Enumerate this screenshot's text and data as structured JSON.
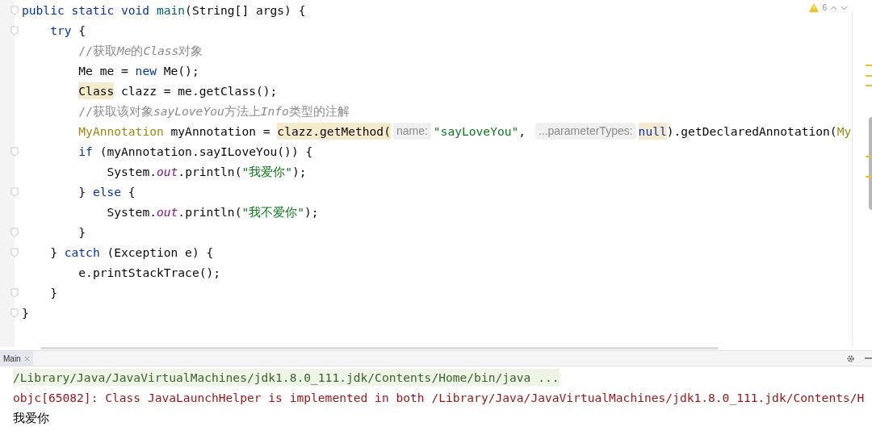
{
  "editor": {
    "inspection": {
      "count": "6"
    },
    "lines": [
      {
        "fold_marker": true,
        "tokens": [
          {
            "kind": "keyword",
            "text": "public static void "
          },
          {
            "kind": "method",
            "text": "main"
          },
          {
            "kind": "plain",
            "text": "(String[] args) {"
          }
        ],
        "children": [
          {
            "fold_marker": true,
            "tokens": [
              {
                "kind": "keyword",
                "text": "try"
              },
              {
                "kind": "plain",
                "text": " {"
              }
            ],
            "children": [
              {
                "fold_marker": false,
                "tokens": [
                  {
                    "kind": "comment",
                    "text": "//获取"
                  },
                  {
                    "kind": "comment_italic",
                    "text": "Me"
                  },
                  {
                    "kind": "comment",
                    "text": "的"
                  },
                  {
                    "kind": "comment_italic",
                    "text": "Class"
                  },
                  {
                    "kind": "comment",
                    "text": "对象"
                  }
                ]
              },
              {
                "fold_marker": false,
                "tokens": [
                  {
                    "kind": "plain",
                    "text": "Me me = "
                  },
                  {
                    "kind": "keyword",
                    "text": "new"
                  },
                  {
                    "kind": "plain",
                    "text": " Me();"
                  }
                ]
              },
              {
                "fold_marker": false,
                "tokens": [
                  {
                    "kind": "plain",
                    "text": "Class",
                    "highlighted": true
                  },
                  {
                    "kind": "plain",
                    "text": " clazz = me.getClass();"
                  }
                ]
              },
              {
                "fold_marker": false,
                "tokens": [
                  {
                    "kind": "comment",
                    "text": "//获取该对象"
                  },
                  {
                    "kind": "comment_italic",
                    "text": "sayLoveYou"
                  },
                  {
                    "kind": "comment",
                    "text": "方法上"
                  },
                  {
                    "kind": "comment_italic",
                    "text": "Info"
                  },
                  {
                    "kind": "comment",
                    "text": "类型的注解"
                  }
                ]
              },
              {
                "fold_marker": false,
                "tokens": [
                  {
                    "kind": "type",
                    "text": "MyAnnotation"
                  },
                  {
                    "kind": "plain",
                    "text": " myAnnotation = "
                  },
                  {
                    "kind": "plain",
                    "text": "clazz.getMethod(",
                    "highlighted": true
                  },
                  {
                    "kind": "hint",
                    "text": "name:"
                  },
                  {
                    "kind": "string",
                    "text": "\"sayLoveYou\""
                  },
                  {
                    "kind": "plain",
                    "text": ", "
                  },
                  {
                    "kind": "hint",
                    "text": "...parameterTypes:"
                  },
                  {
                    "kind": "keyword",
                    "text": "null",
                    "highlighted": true
                  },
                  {
                    "kind": "plain",
                    "text": ").getDeclaredAnnotation("
                  },
                  {
                    "kind": "type",
                    "text": "My"
                  }
                ]
              },
              {
                "fold_marker": true,
                "tokens": [
                  {
                    "kind": "keyword",
                    "text": "if"
                  },
                  {
                    "kind": "plain",
                    "text": " (myAnnotation.sayILoveYou()) {"
                  }
                ],
                "children": [
                  {
                    "fold_marker": false,
                    "tokens": [
                      {
                        "kind": "plain",
                        "text": "System."
                      },
                      {
                        "kind": "static_field",
                        "text": "out"
                      },
                      {
                        "kind": "plain",
                        "text": ".println("
                      },
                      {
                        "kind": "string",
                        "text": "\"我爱你\""
                      },
                      {
                        "kind": "plain",
                        "text": ");"
                      }
                    ]
                  }
                ]
              },
              {
                "fold_marker": true,
                "tokens": [
                  {
                    "kind": "plain",
                    "text": "} "
                  },
                  {
                    "kind": "keyword",
                    "text": "else"
                  },
                  {
                    "kind": "plain",
                    "text": " {"
                  }
                ],
                "children": [
                  {
                    "fold_marker": false,
                    "tokens": [
                      {
                        "kind": "plain",
                        "text": "System."
                      },
                      {
                        "kind": "static_field",
                        "text": "out"
                      },
                      {
                        "kind": "plain",
                        "text": ".println("
                      },
                      {
                        "kind": "string",
                        "text": "\"我不爱你\""
                      },
                      {
                        "kind": "plain",
                        "text": ");"
                      }
                    ]
                  }
                ]
              },
              {
                "fold_marker": true,
                "tokens": [
                  {
                    "kind": "plain",
                    "text": "}"
                  }
                ]
              }
            ]
          },
          {
            "fold_marker": true,
            "tokens": [
              {
                "kind": "plain",
                "text": "} "
              },
              {
                "kind": "keyword",
                "text": "catch"
              },
              {
                "kind": "plain",
                "text": " (Exception e) {"
              }
            ],
            "children": [
              {
                "fold_marker": false,
                "tokens": [
                  {
                    "kind": "plain",
                    "text": "e.printStackTrace();"
                  }
                ]
              }
            ]
          },
          {
            "fold_marker": true,
            "tokens": [
              {
                "kind": "plain",
                "text": "}"
              }
            ]
          }
        ]
      },
      {
        "fold_marker": true,
        "tokens": [
          {
            "kind": "plain",
            "text": "}"
          }
        ]
      }
    ]
  },
  "run_panel": {
    "tab": {
      "label": "Main",
      "selected": true
    },
    "console": [
      {
        "kind": "command",
        "text": "/Library/Java/JavaVirtualMachines/jdk1.8.0_111.jdk/Contents/Home/bin/java ..."
      },
      {
        "kind": "error",
        "text": "objc[65082]: Class JavaLaunchHelper is implemented in both /Library/Java/JavaVirtualMachines/jdk1.8.0_111.jdk/Contents/H"
      },
      {
        "kind": "output",
        "text": "我爱你"
      }
    ]
  }
}
